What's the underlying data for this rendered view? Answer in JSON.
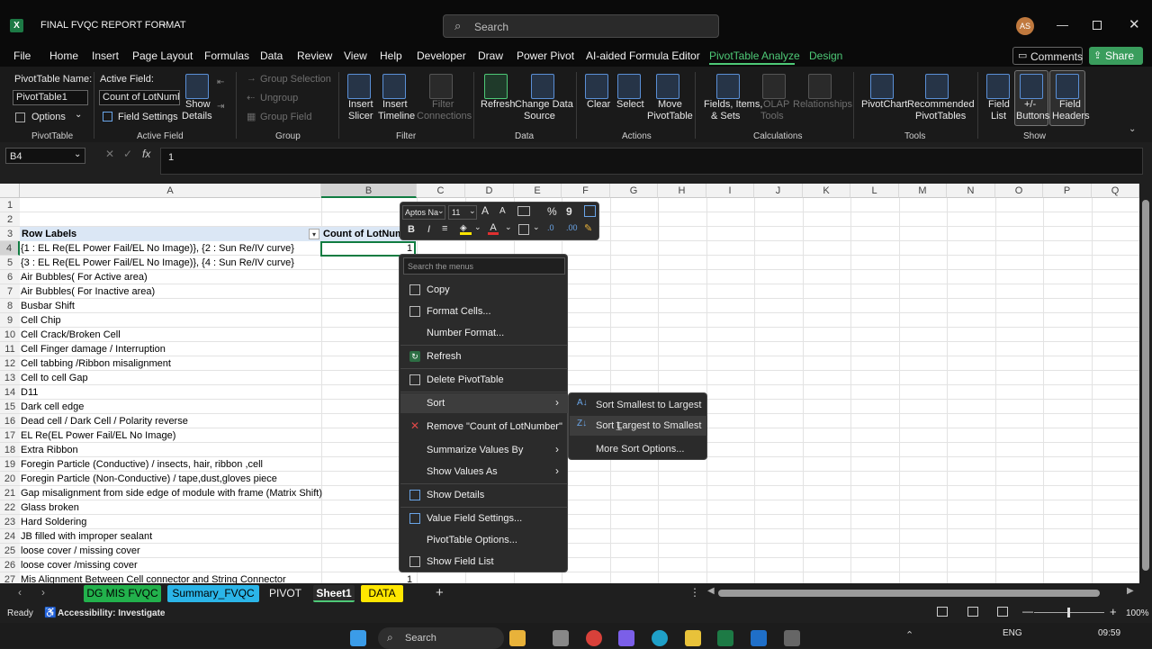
{
  "window": {
    "title": "FINAL FVQC REPORT FORMAT",
    "search_placeholder": "Search",
    "avatar": "AS"
  },
  "menu": [
    "File",
    "Home",
    "Insert",
    "Page Layout",
    "Formulas",
    "Data",
    "Review",
    "View",
    "Help",
    "Developer",
    "Draw",
    "Power Pivot",
    "AI-aided Formula Editor",
    "PivotTable Analyze",
    "Design"
  ],
  "actions": {
    "comments": "Comments",
    "share": "Share"
  },
  "ribbon": {
    "pivot_name_label": "PivotTable Name:",
    "pivot_name_value": "PivotTable1",
    "options": "Options",
    "grp_pivottable": "PivotTable",
    "active_field_label": "Active Field:",
    "active_field_value": "Count of LotNumbe",
    "field_settings": "Field Settings",
    "show_details": [
      "Show",
      "Details"
    ],
    "grp_active_field": "Active Field",
    "group_selection": "Group Selection",
    "ungroup": "Ungroup",
    "group_field": "Group Field",
    "grp_group": "Group",
    "insert_slicer": [
      "Insert",
      "Slicer"
    ],
    "insert_timeline": [
      "Insert",
      "Timeline"
    ],
    "filter_connections": [
      "Filter",
      "Connections"
    ],
    "grp_filter": "Filter",
    "refresh": "Refresh",
    "change_data_source": [
      "Change Data",
      "Source"
    ],
    "grp_data": "Data",
    "clear": "Clear",
    "select": "Select",
    "move_pivottable": [
      "Move",
      "PivotTable"
    ],
    "grp_actions": "Actions",
    "fields_items_sets": [
      "Fields, Items,",
      "& Sets"
    ],
    "olap_tools": [
      "OLAP",
      "Tools"
    ],
    "relationships": "Relationships",
    "grp_calculations": "Calculations",
    "pivotchart": "PivotChart",
    "recommended_pivottables": [
      "Recommended",
      "PivotTables"
    ],
    "grp_tools": "Tools",
    "field_list": [
      "Field",
      "List"
    ],
    "buttons": [
      "+/-",
      "Buttons"
    ],
    "field_headers": [
      "Field",
      "Headers"
    ],
    "grp_show": "Show"
  },
  "formula": {
    "namebox": "B4",
    "value": "1",
    "fx": "fx"
  },
  "columns": [
    "A",
    "B",
    "C",
    "D",
    "E",
    "F",
    "G",
    "H",
    "I",
    "J",
    "K",
    "L",
    "M",
    "N",
    "O",
    "P",
    "Q"
  ],
  "rows": [
    {
      "n": "1",
      "a": ""
    },
    {
      "n": "2",
      "a": ""
    },
    {
      "n": "3",
      "a": "Row Labels"
    },
    {
      "n": "4",
      "a": "{1 :  EL Re(EL Power Fail/EL No Image)},    {2 :  Sun Re/IV curve}"
    },
    {
      "n": "5",
      "a": "{3 :  EL Re(EL Power Fail/EL No Image)},    {4 :  Sun Re/IV curve}"
    },
    {
      "n": "6",
      "a": "Air Bubbles( For Active area)"
    },
    {
      "n": "7",
      "a": "Air Bubbles( For Inactive area)"
    },
    {
      "n": "8",
      "a": "Busbar Shift"
    },
    {
      "n": "9",
      "a": "Cell Chip"
    },
    {
      "n": "10",
      "a": "Cell Crack/Broken Cell"
    },
    {
      "n": "11",
      "a": "Cell Finger damage / Interruption"
    },
    {
      "n": "12",
      "a": "Cell tabbing /Ribbon misalignment"
    },
    {
      "n": "13",
      "a": "Cell to cell Gap"
    },
    {
      "n": "14",
      "a": "D11"
    },
    {
      "n": "15",
      "a": "Dark cell edge"
    },
    {
      "n": "16",
      "a": "Dead cell / Dark Cell / Polarity reverse"
    },
    {
      "n": "17",
      "a": "EL Re(EL Power Fail/EL No Image)"
    },
    {
      "n": "18",
      "a": "Extra Ribbon"
    },
    {
      "n": "19",
      "a": "Foregin Particle (Conductive) / insects, hair, ribbon ,cell"
    },
    {
      "n": "20",
      "a": "Foregin Particle (Non-Conductive) / tape,dust,gloves piece"
    },
    {
      "n": "21",
      "a": "Gap misalignment from side edge of module with frame (Matrix Shift)"
    },
    {
      "n": "22",
      "a": "Glass broken"
    },
    {
      "n": "23",
      "a": "Hard Soldering"
    },
    {
      "n": "24",
      "a": "JB filled with improper sealant"
    },
    {
      "n": "25",
      "a": "loose cover / missing cover"
    },
    {
      "n": "26",
      "a": "loose cover /missing cover"
    },
    {
      "n": "27",
      "a": "Mis Alignment Between Cell connector and String Connector"
    }
  ],
  "pivot": {
    "col_b_header": "Count of LotNum",
    "b4_value": "1",
    "b27_value": "1"
  },
  "mini_toolbar": {
    "font": "Aptos Na",
    "size": "11",
    "bold": "B",
    "italic": "I",
    "percent": "%",
    "comma": "9"
  },
  "context_menu": {
    "search": "Search the menus",
    "items": [
      "Copy",
      "Format Cells...",
      "Number Format...",
      "Refresh",
      "Delete PivotTable",
      "Sort",
      "Remove \"Count of LotNumber\"",
      "Summarize Values By",
      "Show Values As",
      "Show Details",
      "Value Field Settings...",
      "PivotTable Options...",
      "Show Field List"
    ]
  },
  "sort_submenu": [
    "Sort Smallest to Largest",
    "Sort Largest to Smallest",
    "More Sort Options..."
  ],
  "sheets": [
    {
      "name": "DG MIS FVQC",
      "color": "#22b14c",
      "fg": "#000000"
    },
    {
      "name": "Summary_FVQC",
      "color": "#2bb5e8",
      "fg": "#000000"
    },
    {
      "name": "PIVOT",
      "color": "",
      "fg": "#f0f0f0"
    },
    {
      "name": "Sheet1",
      "color": "",
      "fg": "#ffffff"
    },
    {
      "name": "DATA",
      "color": "#ffe600",
      "fg": "#000000"
    }
  ],
  "status": {
    "ready": "Ready",
    "accessibility": "Accessibility: Investigate",
    "zoom": "100%"
  },
  "taskbar": {
    "search": "Search",
    "lang": "ENG",
    "time": "09:59"
  }
}
